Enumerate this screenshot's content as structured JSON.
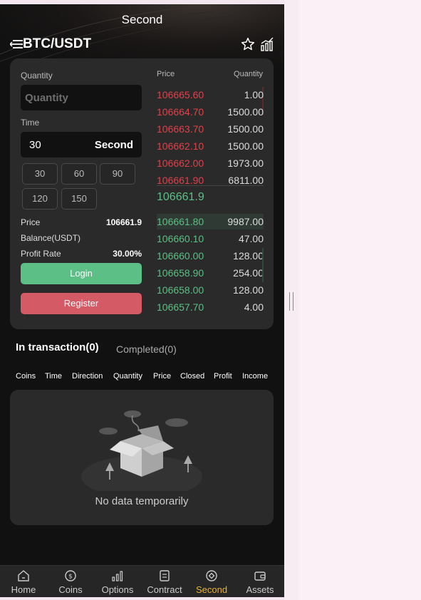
{
  "window": {
    "title": "Second"
  },
  "header": {
    "pair": "BTC/USDT"
  },
  "form": {
    "quantity_label": "Quantity",
    "quantity_placeholder": "Quantity",
    "time_label": "Time",
    "time_value": "30",
    "time_unit": "Second",
    "time_options": [
      "30",
      "60",
      "90",
      "120",
      "150"
    ],
    "price_label": "Price",
    "price_value": "106661.9",
    "balance_label": "Balance(USDT)",
    "balance_value": "",
    "profit_rate_label": "Profit Rate",
    "profit_rate_value": "30.00%",
    "login_label": "Login",
    "register_label": "Register"
  },
  "orderbook": {
    "price_header": "Price",
    "quantity_header": "Quantity",
    "asks": [
      {
        "price": "106665.60",
        "quantity": "1.00"
      },
      {
        "price": "106664.70",
        "quantity": "1500.00"
      },
      {
        "price": "106663.70",
        "quantity": "1500.00"
      },
      {
        "price": "106662.10",
        "quantity": "1500.00"
      },
      {
        "price": "106662.00",
        "quantity": "1973.00"
      },
      {
        "price": "106661.90",
        "quantity": "6811.00"
      }
    ],
    "last_price": "106661.9",
    "bids": [
      {
        "price": "106661.80",
        "quantity": "9987.00"
      },
      {
        "price": "106660.10",
        "quantity": "47.00"
      },
      {
        "price": "106660.00",
        "quantity": "128.00"
      },
      {
        "price": "106658.90",
        "quantity": "254.00"
      },
      {
        "price": "106658.00",
        "quantity": "128.00"
      },
      {
        "price": "106657.70",
        "quantity": "4.00"
      }
    ],
    "colors": {
      "ask": "#e1404b",
      "bid": "#5cbf86"
    }
  },
  "transactions": {
    "tab_active": "In transaction(0)",
    "tab_other": "Completed(0)",
    "columns": [
      "Coins",
      "Time",
      "Direction",
      "Quantity",
      "Price",
      "Closed",
      "Profit",
      "Income"
    ],
    "empty_text": "No data temporarily"
  },
  "nav": {
    "items": [
      {
        "label": "Home",
        "icon": "home-icon"
      },
      {
        "label": "Coins",
        "icon": "coins-icon"
      },
      {
        "label": "Options",
        "icon": "options-icon"
      },
      {
        "label": "Contract",
        "icon": "contract-icon"
      },
      {
        "label": "Second",
        "icon": "second-icon"
      },
      {
        "label": "Assets",
        "icon": "assets-icon"
      }
    ],
    "active_color": "#e6b23a"
  }
}
